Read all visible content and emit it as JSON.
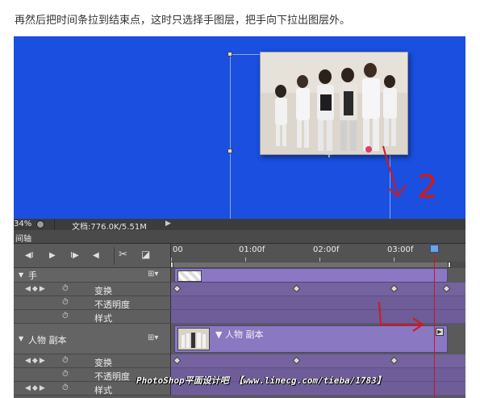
{
  "caption": "再然后把时间条拉到结束点，这时只选择手图层，把手向下拉出图层外。",
  "status": {
    "zoom": "34%",
    "doc": "文档:776.0K/5.51M",
    "play": "▶"
  },
  "panel": {
    "tab": "间轴"
  },
  "controls": {
    "first_frame": "◀I",
    "play": "▶",
    "next_frame": "I▶",
    "audio": "◀",
    "cut": "✂",
    "transition": "◪"
  },
  "ruler": {
    "labels": [
      "00",
      "01:00f",
      "02:00f",
      "03:00f"
    ]
  },
  "layers": {
    "hand": {
      "name": "手",
      "props": [
        "变换",
        "不透明度",
        "样式"
      ]
    },
    "people": {
      "name": "人物 副本",
      "clip_name": "人物 副本",
      "props": [
        "变换",
        "不透明度",
        "样式"
      ]
    }
  },
  "annotation": {
    "number": "2"
  },
  "watermark": "PhotoShop平面设计吧 【www.linecg.com/tieba/1783】",
  "colors": {
    "canvas": "#1a4fe0",
    "clip": "#8a78c2",
    "playhead": "#d0112b"
  }
}
